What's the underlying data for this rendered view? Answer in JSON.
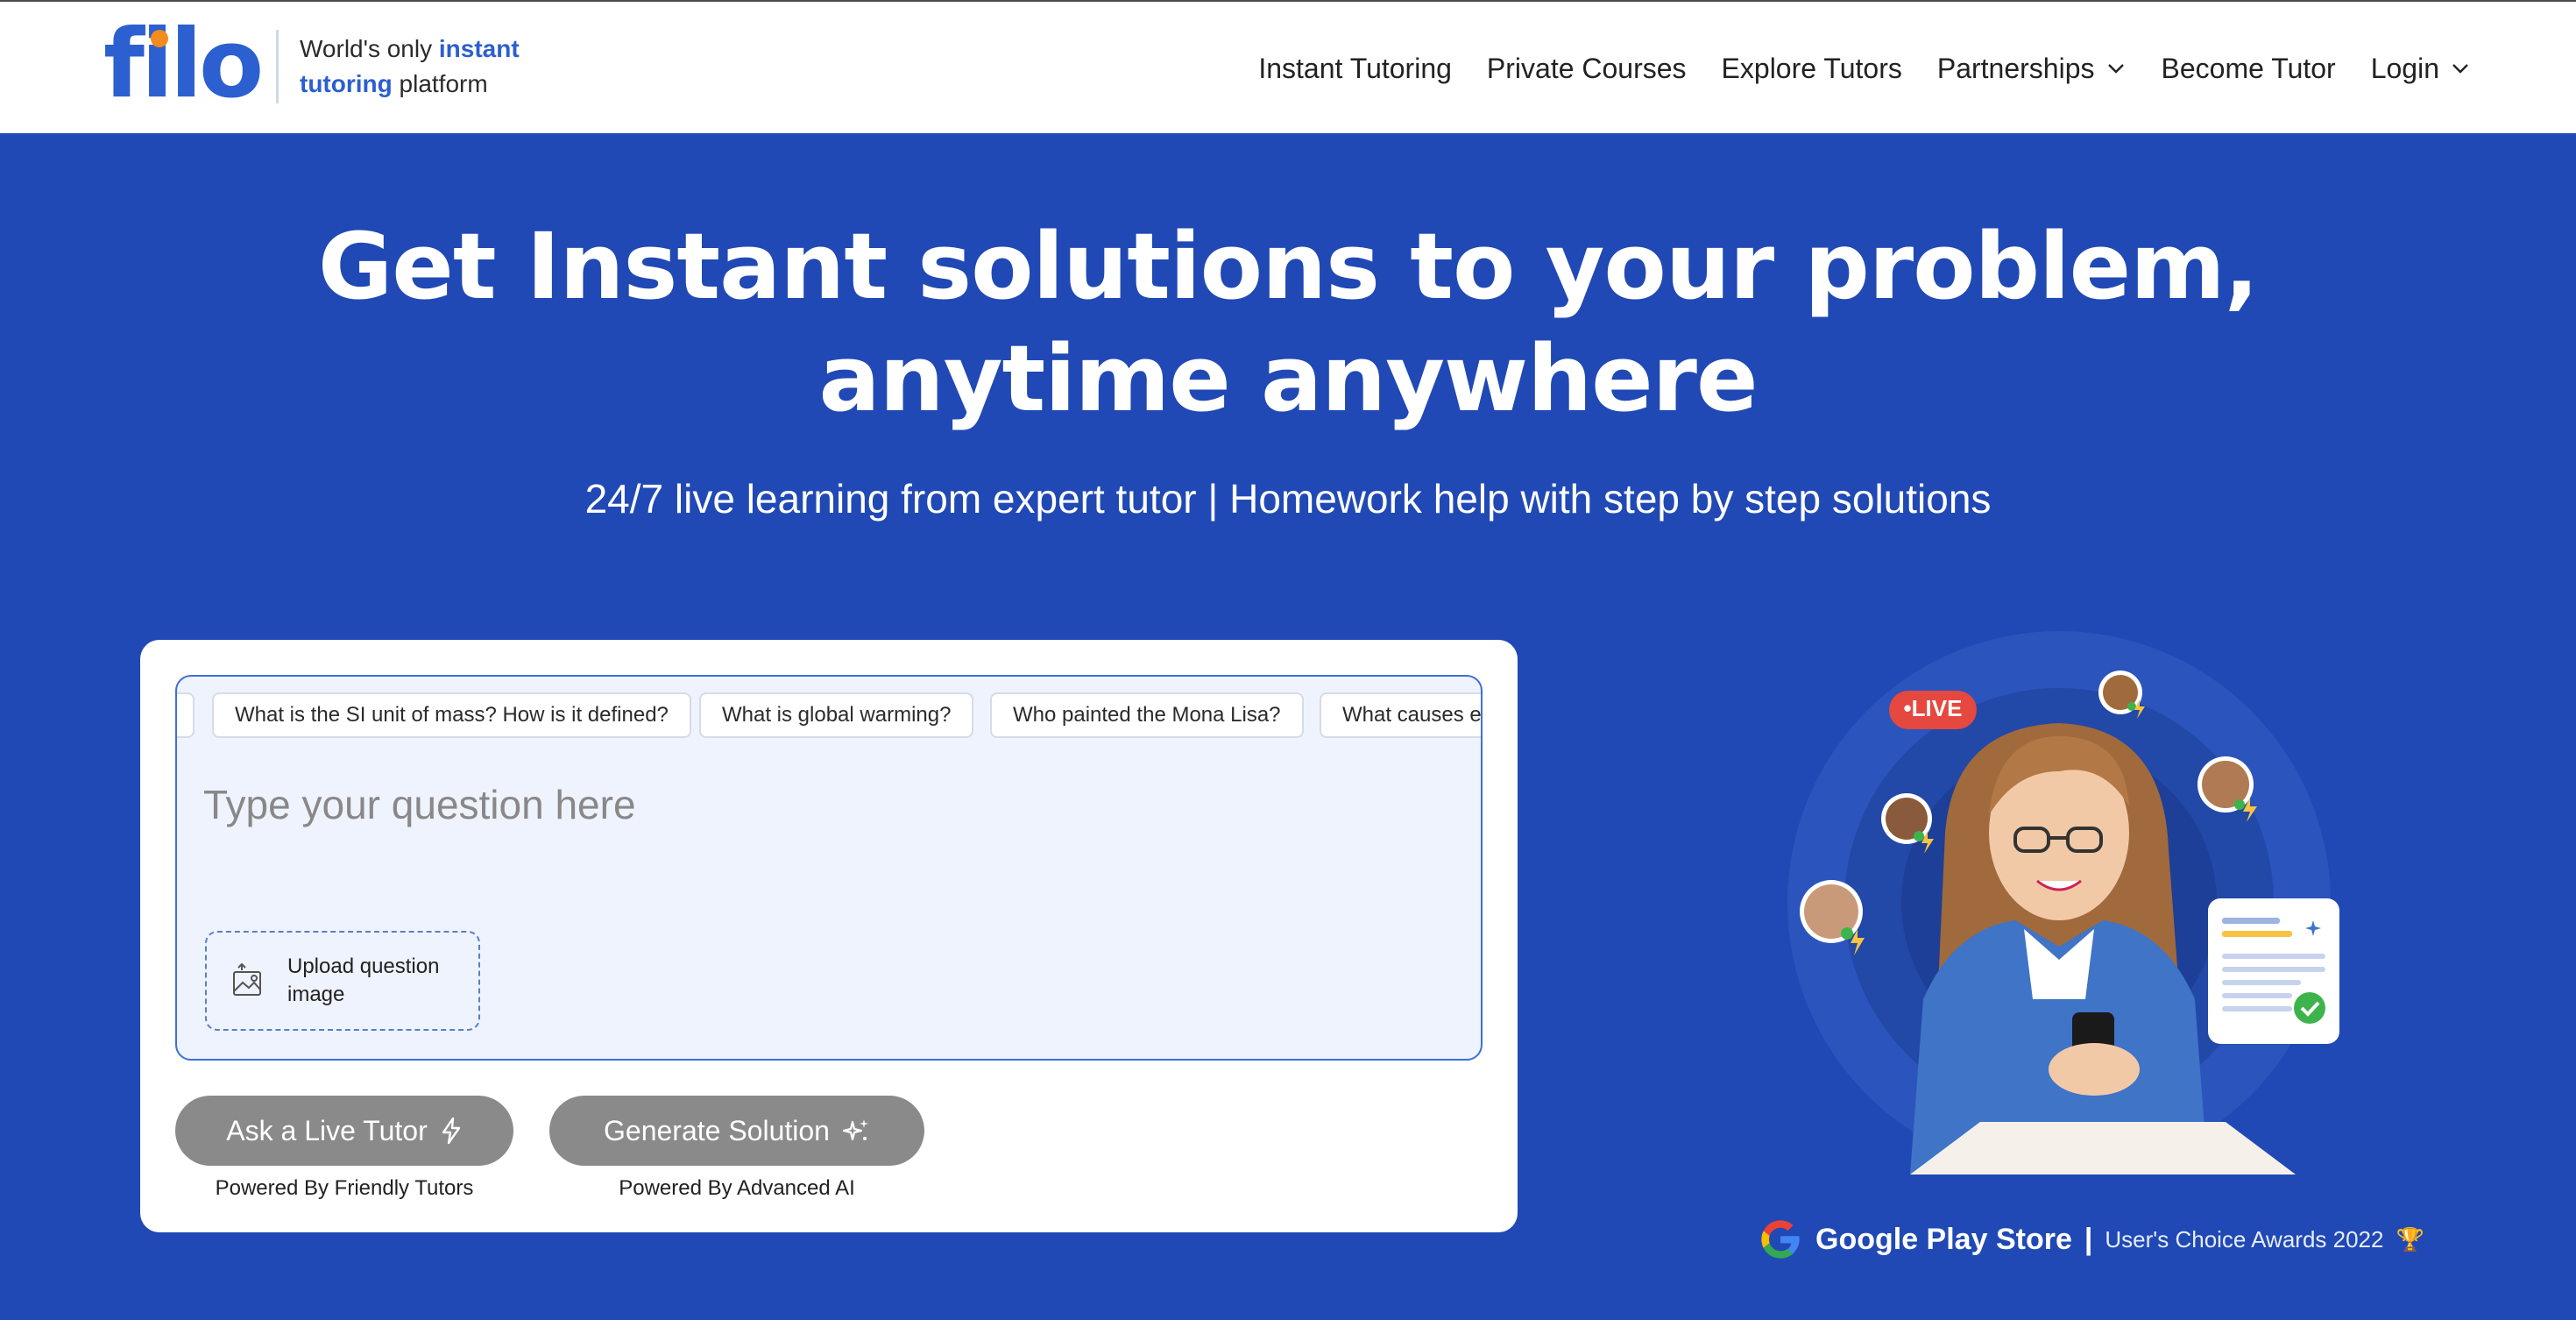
{
  "header": {
    "logo_text": "filo",
    "tagline_prefix": "World's only ",
    "tagline_highlight": "instant tutoring",
    "tagline_suffix": " platform",
    "nav": [
      {
        "label": "Instant Tutoring",
        "dropdown": false
      },
      {
        "label": "Private Courses",
        "dropdown": false
      },
      {
        "label": "Explore Tutors",
        "dropdown": false
      },
      {
        "label": "Partnerships",
        "dropdown": true
      },
      {
        "label": "Become Tutor",
        "dropdown": false
      },
      {
        "label": "Login",
        "dropdown": true
      }
    ]
  },
  "hero": {
    "title": "Get Instant solutions to your problem, anytime anywhere",
    "subtitle": "24/7 live learning from expert tutor | Homework help with step by step solutions"
  },
  "question_card": {
    "suggestions": [
      "What is the SI unit of mass? How is it defined?",
      "What is global warming?",
      "Who painted the Mona Lisa?",
      "What causes earthquakes?"
    ],
    "input_placeholder": "Type your question here",
    "upload_label": "Upload question image",
    "live_tutor_button": "Ask a Live Tutor",
    "live_tutor_caption": "Powered By Friendly Tutors",
    "generate_button": "Generate Solution",
    "generate_caption": "Powered By Advanced AI"
  },
  "illustration": {
    "live_badge": "•LIVE"
  },
  "award": {
    "store": "Google Play Store",
    "separator": "|",
    "text": "User's Choice Awards 2022",
    "trophy": "🏆"
  },
  "colors": {
    "brand_blue": "#2c5fcf",
    "hero_bg": "#2049b5",
    "logo_accent": "#f28c1e",
    "button_disabled": "#8a8a8a",
    "live_red": "#e5483f"
  },
  "icons": [
    "chevron-down-icon",
    "upload-image-icon",
    "lightning-icon",
    "sparkle-icon",
    "google-g-icon",
    "trophy-icon"
  ]
}
